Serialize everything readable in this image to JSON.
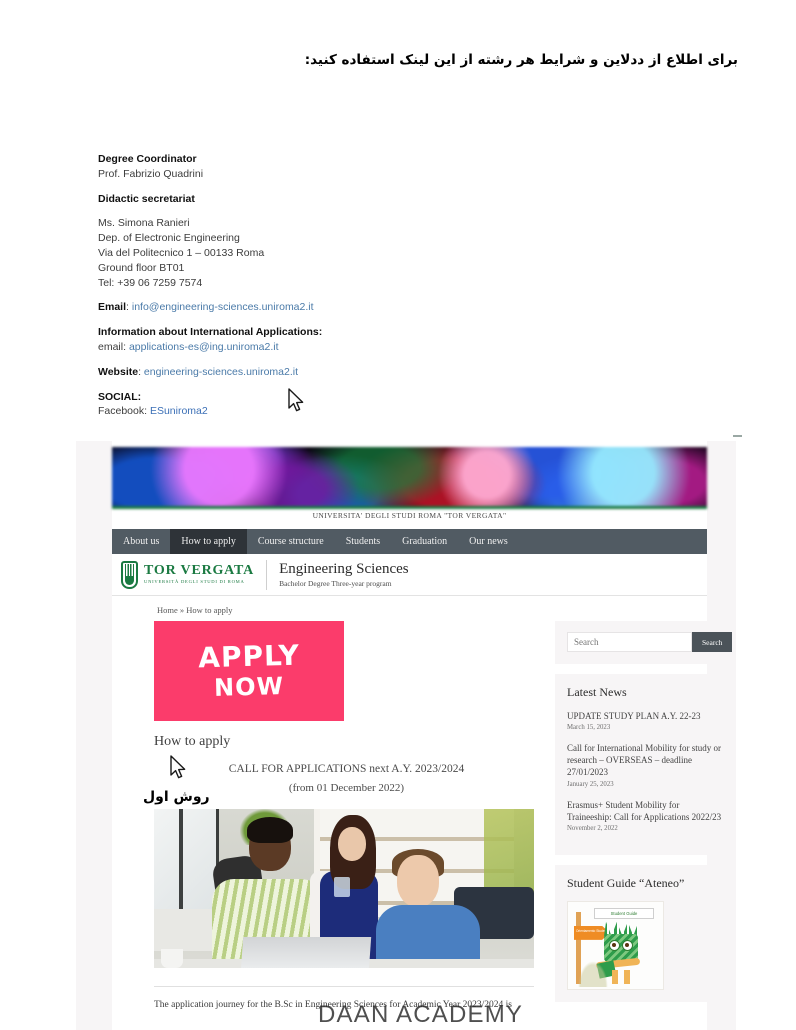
{
  "top_note": "برای اطلاع از ددلاین و شرایط هر رشته از این لینک استفاده کنید:",
  "contact": {
    "coordinator_label": "Degree Coordinator",
    "coordinator_name": "Prof. Fabrizio Quadrini",
    "secretariat_label": "Didactic secretariat",
    "secretariat_name": "Ms. Simona Ranieri",
    "department": "Dep. of Electronic Engineering",
    "address": "Via del Politecnico 1 – 00133 Roma",
    "floor": "Ground floor BT01",
    "tel": "Tel: +39 06 7259 7574",
    "email_label": "Email",
    "email_value": "info@engineering-sciences.uniroma2.it",
    "intl_label": "Information about International Applications:",
    "intl_email_prefix": "email: ",
    "intl_email_value": "applications-es@ing.uniroma2.it",
    "website_label": "Website",
    "website_value": "engineering-sciences.uniroma2.it",
    "social_label": "SOCIAL:",
    "facebook_prefix": "Facebook: ",
    "facebook_value": "ESuniroma2"
  },
  "site": {
    "university_caption": "UNIVERSITA' DEGLI STUDI ROMA \"TOR VERGATA\"",
    "nav": [
      {
        "label": "About us",
        "active": false
      },
      {
        "label": "How to apply",
        "active": true
      },
      {
        "label": "Course structure",
        "active": false
      },
      {
        "label": "Students",
        "active": false
      },
      {
        "label": "Graduation",
        "active": false
      },
      {
        "label": "Our news",
        "active": false
      }
    ],
    "logo_main": "TOR VERGATA",
    "logo_sub": "UNIVERSITÀ DEGLI STUDI DI ROMA",
    "site_title": "Engineering Sciences",
    "site_subtitle": "Bachelor Degree Three-year program",
    "breadcrumb": "Home » How to apply",
    "apply_banner_line1": "APPLY",
    "apply_banner_line2": "NOW",
    "page_heading": "How to apply",
    "call_line1": "CALL FOR APPLICATIONS next A.Y. 2023/2024",
    "call_line2": "(from 01 December 2022)",
    "body_paragraph": "The application journey for the B.Sc in Engineering Sciences for Academic Year 2023/2024 is",
    "colors": {
      "nav_bg": "#515b63",
      "nav_active_bg": "#2e3338",
      "brand_green": "#1b7a42",
      "apply_pink": "#fb3c6b",
      "widget_bg": "#f7f5f6",
      "search_btn": "#4b5359"
    }
  },
  "sidebar": {
    "search_placeholder": "Search",
    "search_button": "Search",
    "latest_news_title": "Latest News",
    "news": [
      {
        "title": "UPDATE STUDY PLAN A.Y. 22-23",
        "date": "March 15, 2023"
      },
      {
        "title": "Call for International Mobility for study or research – OVERSEAS – deadline 27/01/2023",
        "date": "January 25, 2023"
      },
      {
        "title": "Erasmus+ Student Mobility for Traineeship: Call for Applications 2022/23",
        "date": "November 2, 2022"
      }
    ],
    "student_guide_title": "Student Guide “Ateneo”",
    "guide_image_label": "Student Guide",
    "guide_arrow_text": "Orientamento Studenti"
  },
  "annotations": {
    "method_one": "روش اول",
    "watermark": "DAAN ACADEMY"
  }
}
